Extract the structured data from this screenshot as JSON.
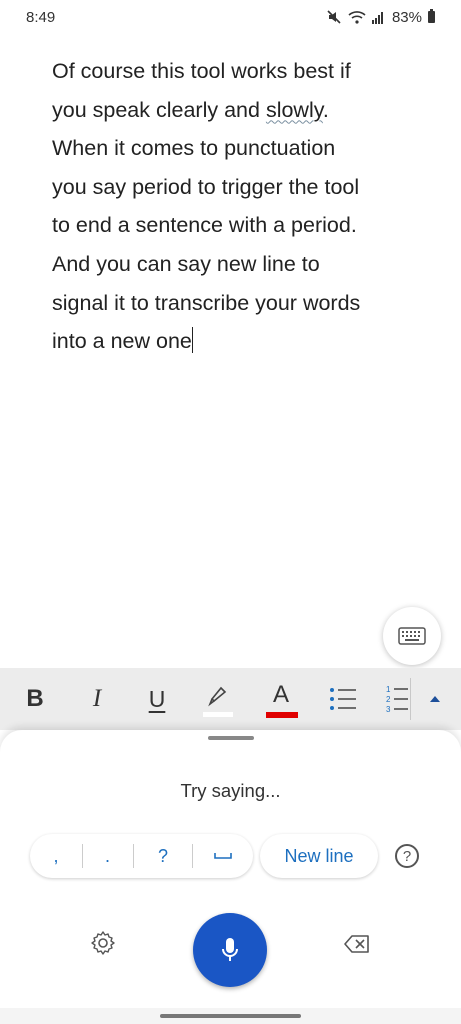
{
  "status_bar": {
    "time": "8:49",
    "battery_text": "83%",
    "icons": [
      "mute-icon",
      "wifi-icon",
      "signal-icon",
      "battery-icon"
    ]
  },
  "document": {
    "lines": [
      "Of course this tool works best if",
      "you speak clearly and ",
      "When it comes to punctuation",
      "you say period to trigger the tool",
      "to end a sentence with a period.",
      "And you can say new line to",
      "signal it to transcribe your words",
      "into a new one"
    ],
    "underlined_word": "slowly",
    "after_underlined": "."
  },
  "toolbar": {
    "bold": "B",
    "italic": "I",
    "underline": "U",
    "font_color_letter": "A",
    "font_color": "#e00000",
    "highlight_color": "#ffffff"
  },
  "dictation": {
    "prompt": "Try saying...",
    "punctuation": [
      ",",
      ".",
      "?",
      "␣"
    ],
    "new_line": "New line",
    "help": "?",
    "mic_color": "#1a56c5"
  }
}
